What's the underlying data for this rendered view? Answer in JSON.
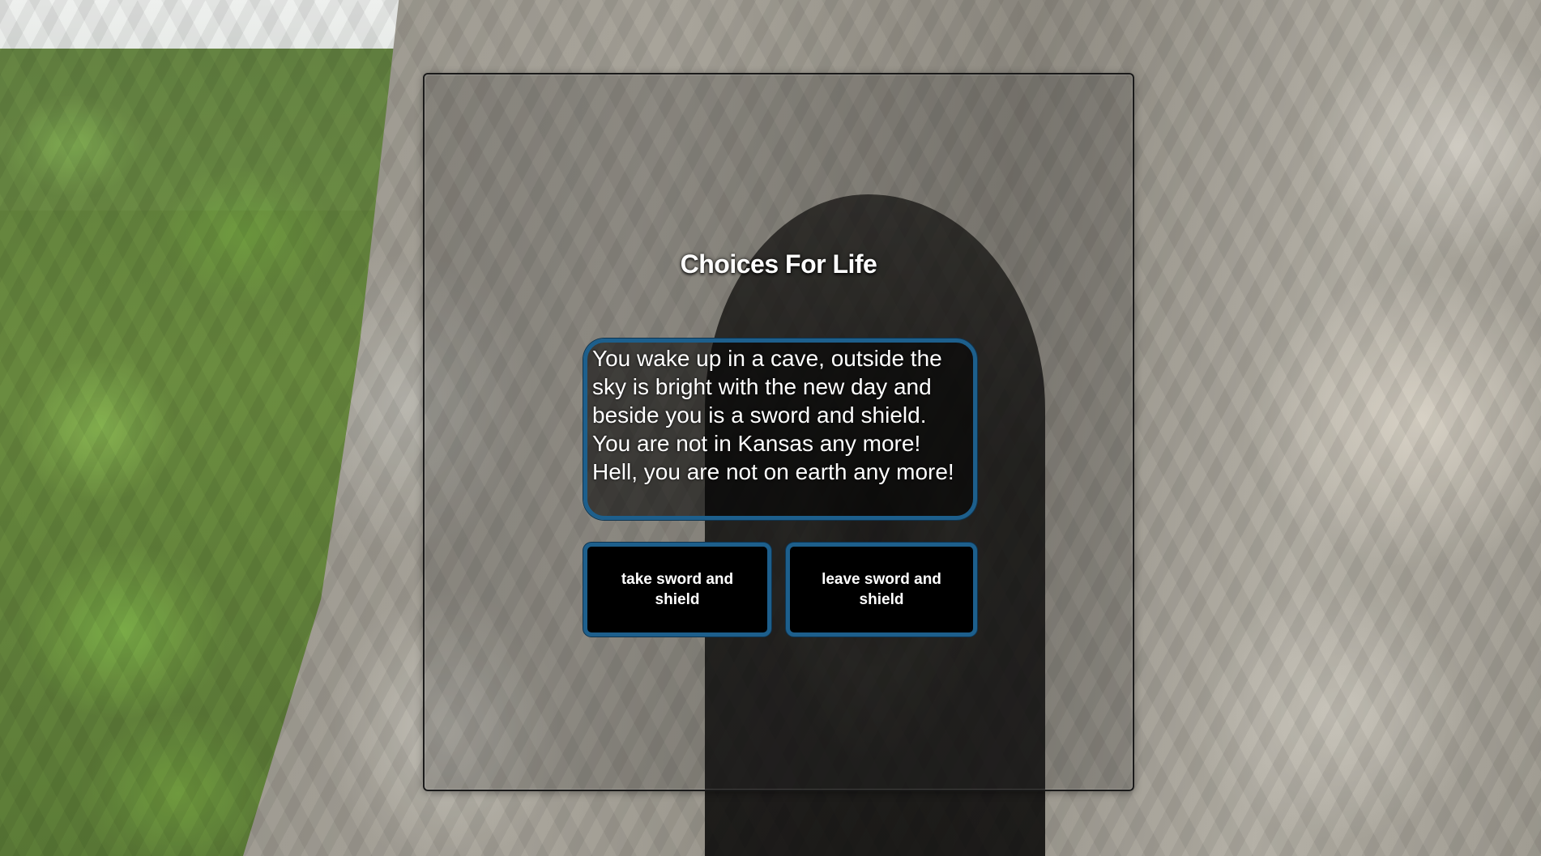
{
  "game": {
    "title": "Choices For Life",
    "story_text": "You wake up in a cave, outside the sky is bright with the new day and beside you is a sword and shield. You are not in Kansas any more! Hell, you are not on earth any more!",
    "choices": [
      {
        "label": "take sword and shield"
      },
      {
        "label": "leave sword and shield"
      }
    ]
  },
  "colors": {
    "accent_border": "#1d5f8c",
    "button_background": "#000000",
    "text": "#ffffff"
  }
}
